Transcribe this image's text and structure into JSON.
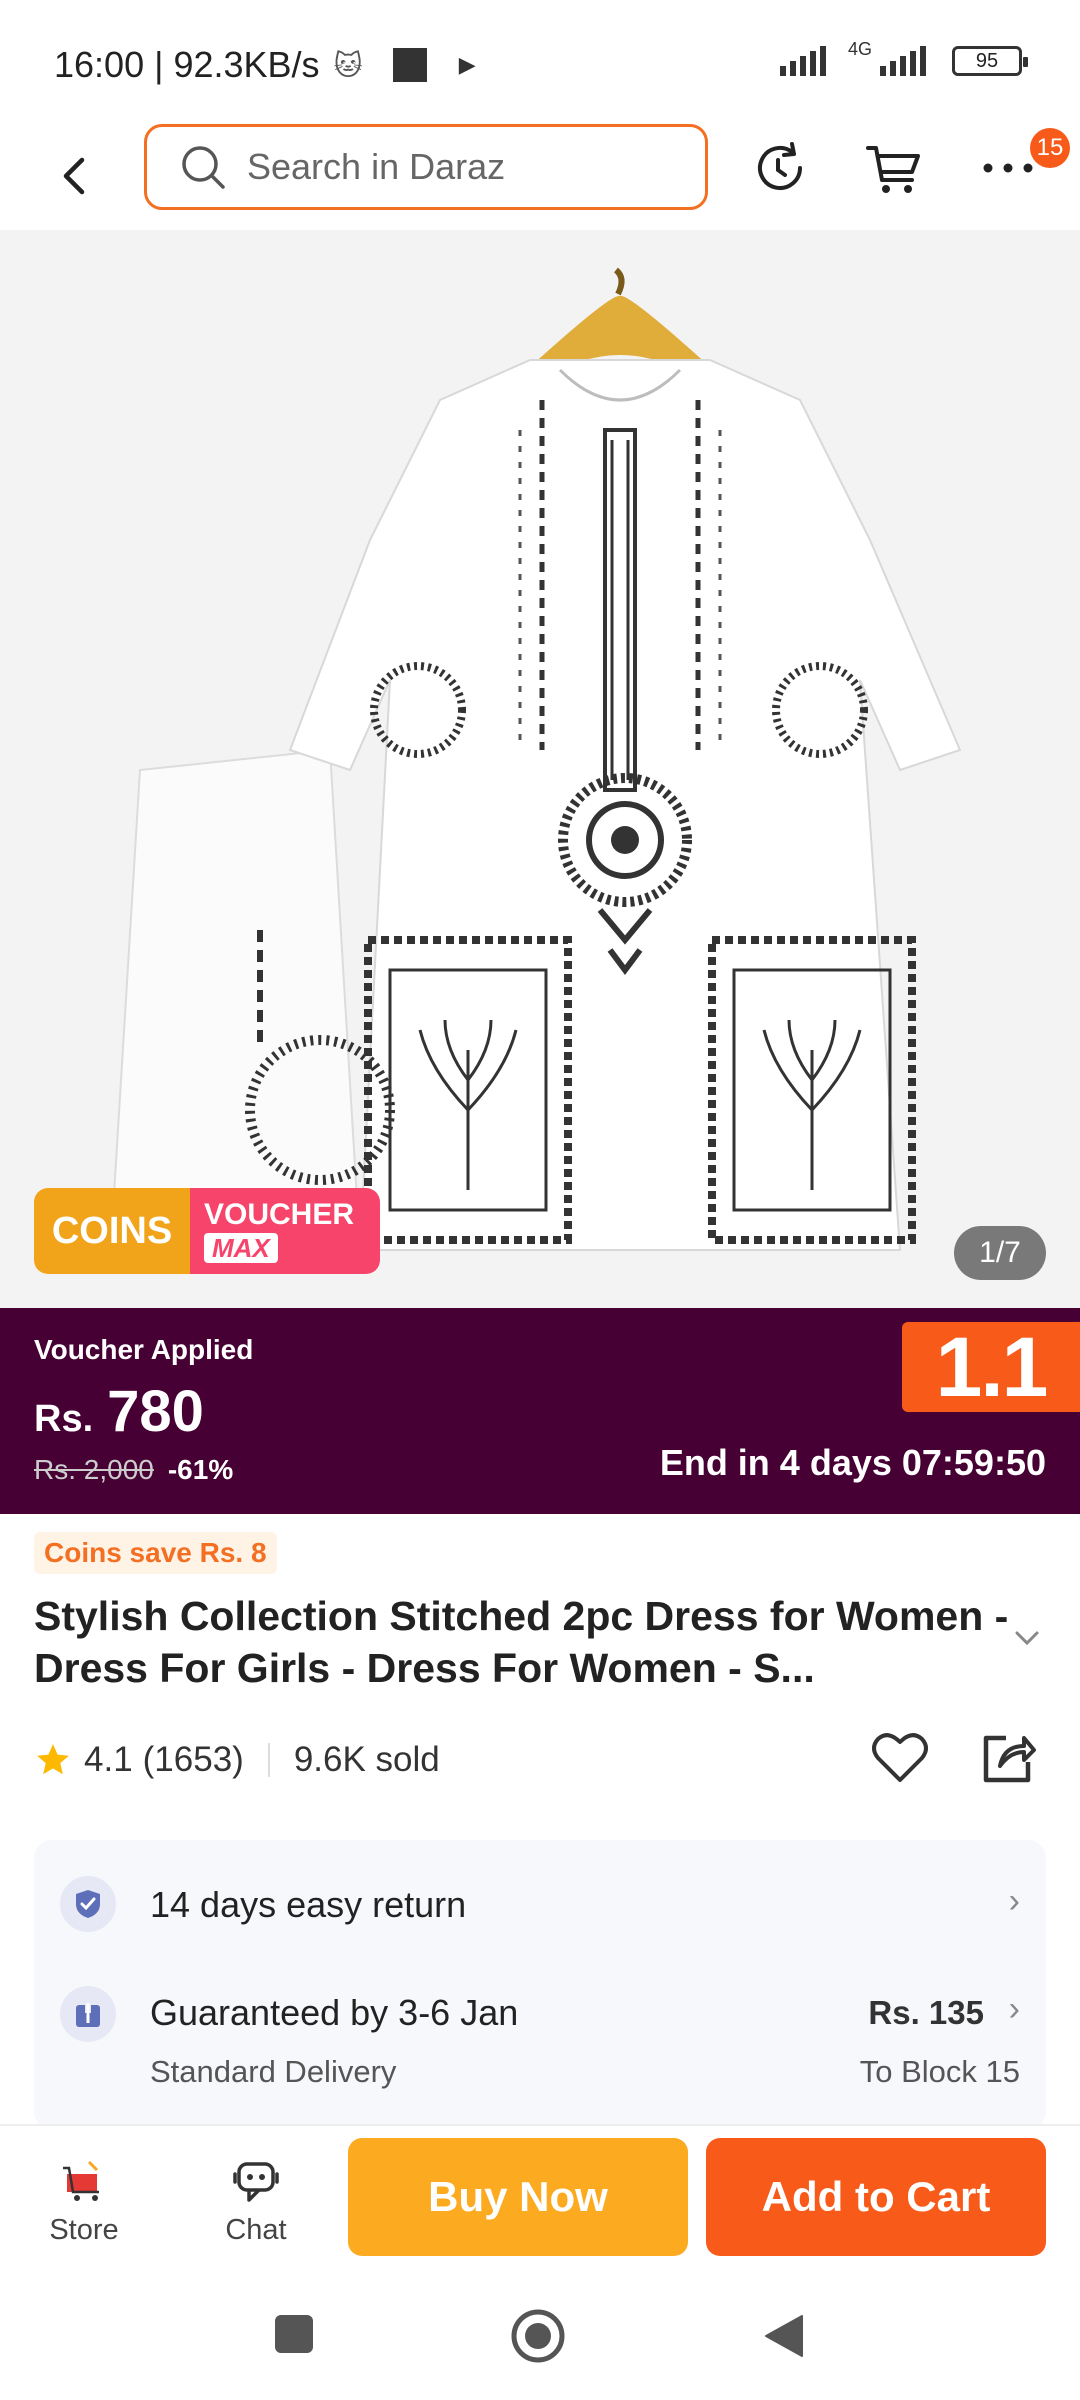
{
  "status_bar": {
    "time_speed": "16:00 | 92.3KB/s",
    "network_label": "4G",
    "battery": "95"
  },
  "top_nav": {
    "search_placeholder": "Search in Daraz",
    "menu_badge_count": "15"
  },
  "gallery": {
    "coins_label": "COINS",
    "voucher_label": "VOUCHER",
    "voucher_max_label": "MAX",
    "counter": "1/7"
  },
  "price_banner": {
    "voucher_applied": "Voucher Applied",
    "currency": "Rs.",
    "price": "780",
    "original_price": "Rs. 2,000",
    "discount": "-61%",
    "sale_tag": "1.1",
    "countdown": "End in 4 days 07:59:50"
  },
  "product": {
    "coins_save": "Coins save Rs. 8",
    "title": "Stylish Collection Stitched 2pc Dress for Women - Dress For Girls - Dress For Women - S...",
    "rating": "4.1",
    "review_count": "(1653)",
    "sold": "9.6K sold"
  },
  "services": {
    "return_label": "14 days easy return",
    "delivery_title": "Guaranteed by 3-6 Jan",
    "delivery_type": "Standard Delivery",
    "delivery_fee": "Rs. 135",
    "delivery_location": "To Block 15"
  },
  "bottom_bar": {
    "store_label": "Store",
    "chat_label": "Chat",
    "buy_now_label": "Buy Now",
    "add_to_cart_label": "Add to Cart"
  },
  "colors": {
    "brand_orange": "#f85a19",
    "buy_now_yellow": "#fcaa1f",
    "banner_purple": "#470034"
  }
}
